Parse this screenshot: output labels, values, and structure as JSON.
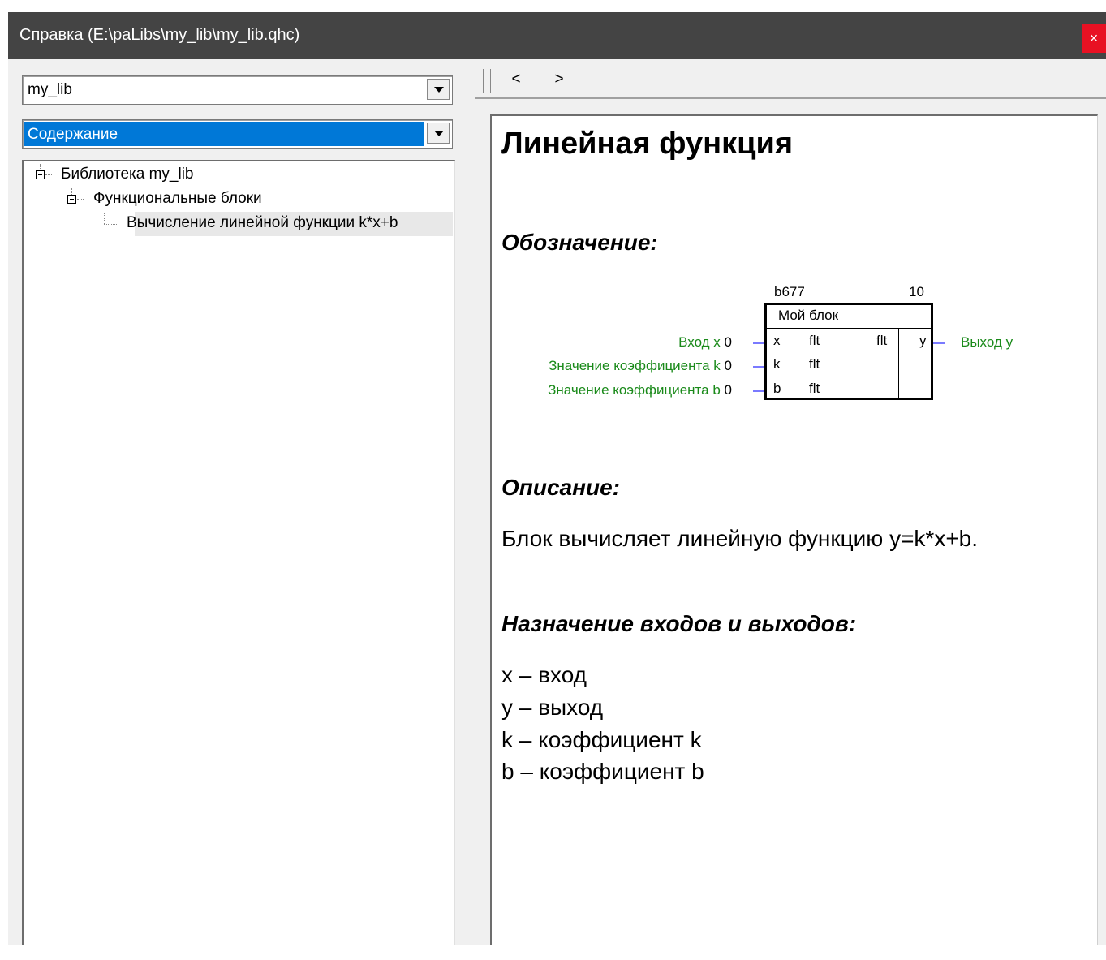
{
  "window": {
    "title": "Справка (E:\\paLibs\\my_lib\\my_lib.qhc)",
    "close_label": "×"
  },
  "sidebar": {
    "library_select": "my_lib",
    "view_select": "Содержание",
    "tree": [
      {
        "label": "Библиотека my_lib"
      },
      {
        "label": "Функциональные блоки"
      },
      {
        "label": "Вычисление линейной функции k*x+b"
      }
    ]
  },
  "toolbar": {
    "back": "<",
    "forward": ">"
  },
  "content": {
    "title": "Линейная функция",
    "designation_heading": "Обозначение:",
    "block": {
      "id": "b677",
      "number": "10",
      "name": "Мой блок",
      "inputs": [
        {
          "label": "Вход x",
          "value": "0",
          "pin": "x",
          "type": "flt"
        },
        {
          "label": "Значение коэффициента k",
          "value": "0",
          "pin": "k",
          "type": "flt"
        },
        {
          "label": "Значение коэффициента b",
          "value": "0",
          "pin": "b",
          "type": "flt"
        }
      ],
      "output": {
        "type": "flt",
        "pin": "y",
        "label": "Выход y"
      }
    },
    "description_heading": "Описание:",
    "description": "Блок вычисляет линейную функцию y=k*x+b.",
    "io_heading": "Назначение входов и выходов:",
    "io_list": [
      "x – вход",
      "y – выход",
      "k – коэффициент k",
      "b – коэффициент b"
    ]
  },
  "colors": {
    "accent": "#0078d7",
    "titlebar": "#444444",
    "close": "#e81123",
    "label_green": "#1a8a1a",
    "pin_line": "#7a7aff"
  }
}
